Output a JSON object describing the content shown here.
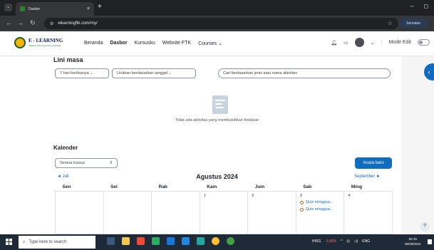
{
  "browser": {
    "tab_title": "Dasbor",
    "tab_close": "×",
    "new_tab": "+",
    "url": "elearningftk.com/my/",
    "profile_label": "Sematan",
    "minimize": "–",
    "maximize": "◻"
  },
  "site": {
    "logo_title": "E - LEARNING",
    "logo_subtitle": "Fakultas Teknologi dan Kesehatan",
    "nav": [
      "Beranda",
      "Dasbor",
      "Kursusku",
      "Website FTK",
      "Courses"
    ],
    "active_nav": "Dasbor",
    "mode_edit": "Mode Edit"
  },
  "timeline": {
    "heading": "Lini masa",
    "filter_days": "7 hari berikutnya",
    "sort": "Urutkan berdasarkan tanggal",
    "search_placeholder": "Cari berdasarkan jenis atau nama aktivitas",
    "empty_text": "Tidak ada aktivitas yang membutuhkan tindakan"
  },
  "calendar": {
    "heading": "Kalender",
    "course_filter": "Semua kursus",
    "new_event": "Acara baru",
    "prev_month": "◄ Juli",
    "month_title": "Agustus 2024",
    "next_month": "September ►",
    "weekdays": [
      "Sen",
      "Sel",
      "Rab",
      "Kam",
      "Jum",
      "Sab",
      "Ming"
    ],
    "days": [
      "",
      "",
      "",
      "1",
      "2",
      "3",
      "4"
    ],
    "events_day": "3",
    "events": [
      "Quiz minggua...",
      "Quiz minggua..."
    ]
  },
  "taskbar": {
    "search_placeholder": "Type here to search",
    "ticker": "IHSG",
    "ticker_change": "-3,40%",
    "language": "ENG",
    "time": "06:15",
    "date": "05/08/2024"
  },
  "colors": {
    "primary": "#0f6cbf",
    "event_dot": "#e8590c",
    "taskbar": "#1f2a38"
  }
}
